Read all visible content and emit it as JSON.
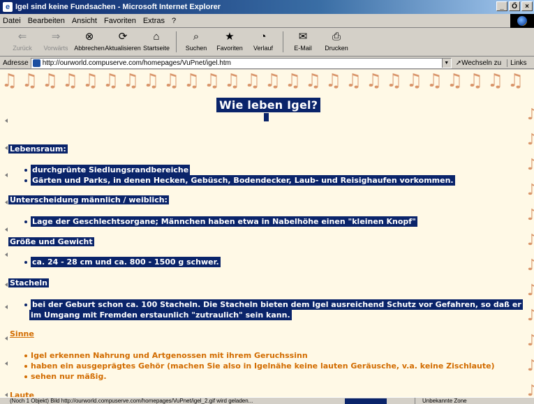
{
  "window": {
    "title": "Igel sind keine Fundsachen - Microsoft Internet Explorer",
    "controls": [
      "_",
      "Ő",
      "×"
    ]
  },
  "menu": [
    "Datei",
    "Bearbeiten",
    "Ansicht",
    "Favoriten",
    "Extras",
    "?"
  ],
  "toolbar": [
    {
      "label": "Zurück",
      "icon": "back-arrow-icon",
      "glyph": "⇐",
      "enabled": false
    },
    {
      "label": "Vorwärts",
      "icon": "forward-arrow-icon",
      "glyph": "⇒",
      "enabled": false
    },
    {
      "label": "Abbrechen",
      "icon": "stop-icon",
      "glyph": "⊗",
      "enabled": true
    },
    {
      "label": "Aktualisieren",
      "icon": "refresh-icon",
      "glyph": "⟳",
      "enabled": true
    },
    {
      "label": "Startseite",
      "icon": "home-icon",
      "glyph": "⌂",
      "enabled": true
    },
    {
      "label": "Suchen",
      "icon": "search-icon",
      "glyph": "⌕",
      "enabled": true
    },
    {
      "label": "Favoriten",
      "icon": "favorites-icon",
      "glyph": "★",
      "enabled": true
    },
    {
      "label": "Verlauf",
      "icon": "history-icon",
      "glyph": "◔",
      "enabled": true
    },
    {
      "label": "E-Mail",
      "icon": "mail-icon",
      "glyph": "✉",
      "enabled": true
    },
    {
      "label": "Drucken",
      "icon": "print-icon",
      "glyph": "⎙",
      "enabled": true
    }
  ],
  "address": {
    "label": "Adresse",
    "value": "http://ourworld.compuserve.com/homepages/VuPnet/igel.htm",
    "go": "Wechseln zu",
    "links": "Links"
  },
  "page": {
    "title": "Wie leben Igel?",
    "sections": [
      {
        "heading": "Lebensraum:",
        "items": [
          "durchgrünte Siedlungsrandbereiche",
          "Gärten und Parks, in denen Hecken, Gebüsch, Bodendecker, Laub- und Reisighaufen vorkommen."
        ]
      },
      {
        "heading": "Unterscheidung männlich / weiblich:",
        "items": [
          "Lage der Geschlechtsorgane; Männchen haben etwa in Nabelhöhe einen \"kleinen Knopf\""
        ]
      },
      {
        "heading": "Größe und Gewicht",
        "items": [
          "ca. 24 - 28 cm und ca. 800 - 1500 g schwer."
        ]
      },
      {
        "heading": "Stacheln",
        "items": [
          "bei der Geburt schon ca. 100 Stacheln. Die Stacheln bieten dem Igel ausreichend Schutz vor Gefahren, so daß er",
          "im Umgang mit Fremden erstaunlich \"zutraulich\" sein kann."
        ]
      },
      {
        "heading": "Sinne",
        "items": [
          "Igel erkennen Nahrung und Artgenossen mit ihrem Geruchssinn",
          "haben ein ausgeprägtes Gehör (machen Sie also in Igelnähe keine lauten Geräusche, v.a. keine Zischlaute)",
          "sehen nur mäßig."
        ]
      },
      {
        "heading": "Laute"
      }
    ]
  },
  "status": {
    "text": "(Noch 1 Objekt) Bild http://ourworld.compuserve.com/homepages/VuPnet/igel_2.gif wird geladen...",
    "zone": "Unbekannte Zone"
  },
  "colors": {
    "highlight": "#0a246a",
    "page_bg": "#fff9e6",
    "orange_text": "#d26c00",
    "note": "#d9956a"
  }
}
